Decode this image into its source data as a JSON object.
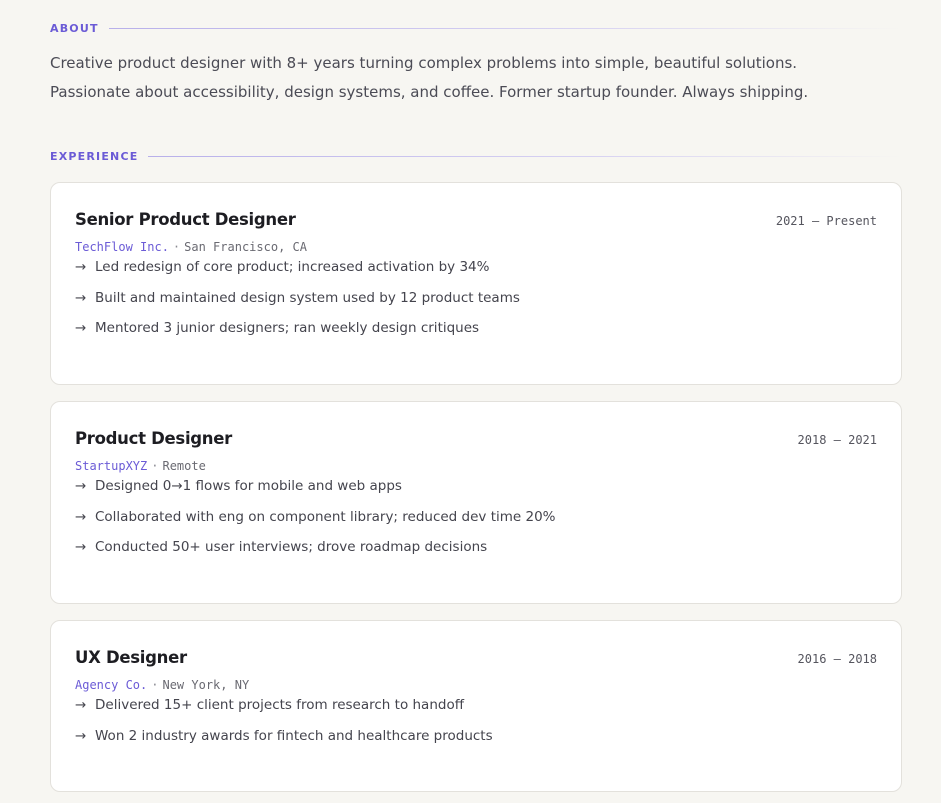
{
  "about": {
    "heading": "ABOUT",
    "text": "Creative product designer with 8+ years turning complex problems into simple, beautiful solutions. Passionate about accessibility, design systems, and coffee. Former startup founder. Always shipping."
  },
  "experience": {
    "heading": "EXPERIENCE",
    "bullet_glyph": "→",
    "jobs": [
      {
        "title": "Senior Product Designer",
        "dates": "2021 – Present",
        "company": "TechFlow Inc.",
        "separator": "·",
        "location": "San Francisco, CA",
        "bullets": [
          "Led redesign of core product; increased activation by 34%",
          "Built and maintained design system used by 12 product teams",
          "Mentored 3 junior designers; ran weekly design critiques"
        ]
      },
      {
        "title": "Product Designer",
        "dates": "2018 – 2021",
        "company": "StartupXYZ",
        "separator": "·",
        "location": "Remote",
        "bullets": [
          "Designed 0→1 flows for mobile and web apps",
          "Collaborated with eng on component library; reduced dev time 20%",
          "Conducted 50+ user interviews; drove roadmap decisions"
        ]
      },
      {
        "title": "UX Designer",
        "dates": "2016 – 2018",
        "company": "Agency Co.",
        "separator": "·",
        "location": "New York, NY",
        "bullets": [
          "Delivered 15+ client projects from research to handoff",
          "Won 2 industry awards for fintech and healthcare products"
        ]
      }
    ]
  },
  "colors": {
    "accent": "#6b5bd6",
    "background": "#f7f6f2",
    "card": "#ffffff"
  }
}
